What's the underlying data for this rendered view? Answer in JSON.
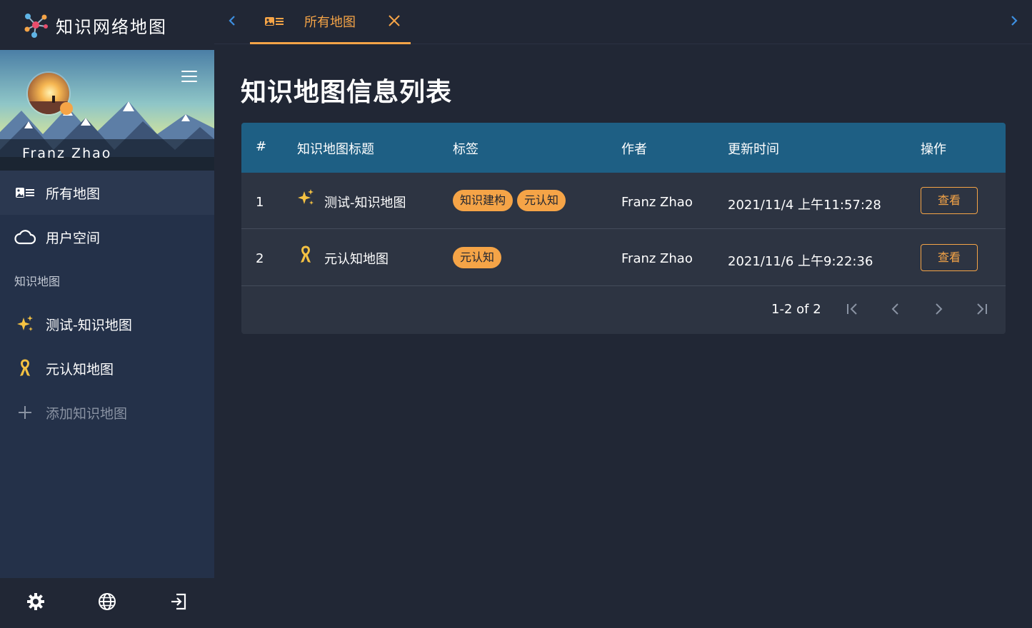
{
  "app": {
    "title": "知识网络地图"
  },
  "sidebar": {
    "user_name": "Franz Zhao",
    "items": [
      {
        "label": "所有地图",
        "icon": "map-list-icon",
        "active": true
      },
      {
        "label": "用户空间",
        "icon": "cloud-icon",
        "active": false
      }
    ],
    "section_label": "知识地图",
    "maps": [
      {
        "label": "测试-知识地图",
        "icon": "sparkles-icon"
      },
      {
        "label": "元认知地图",
        "icon": "ribbon-icon"
      }
    ],
    "add_label": "添加知识地图",
    "footer": [
      "settings-icon",
      "globe-icon",
      "logout-icon"
    ]
  },
  "tabs": [
    {
      "label": "所有地图",
      "icon": "map-list-icon",
      "active": true
    }
  ],
  "main": {
    "title": "知识地图信息列表",
    "table": {
      "headers": [
        "#",
        "知识地图标题",
        "标签",
        "作者",
        "更新时间",
        "操作"
      ],
      "rows": [
        {
          "index": "1",
          "title": "测试-知识地图",
          "icon": "sparkles-icon",
          "tags": [
            "知识建构",
            "元认知"
          ],
          "author": "Franz Zhao",
          "updated": "2021/11/4 上午11:57:28",
          "action": "查看"
        },
        {
          "index": "2",
          "title": "元认知地图",
          "icon": "ribbon-icon",
          "tags": [
            "元认知"
          ],
          "author": "Franz Zhao",
          "updated": "2021/11/6 上午9:22:36",
          "action": "查看"
        }
      ],
      "pagination": "1-2 of 2"
    }
  },
  "colors": {
    "accent": "#f5a447",
    "header": "#1e5f84",
    "background": "#212735",
    "sidebar": "#243149",
    "card": "#2d3442",
    "tab_arrow": "#3d8fe0"
  }
}
